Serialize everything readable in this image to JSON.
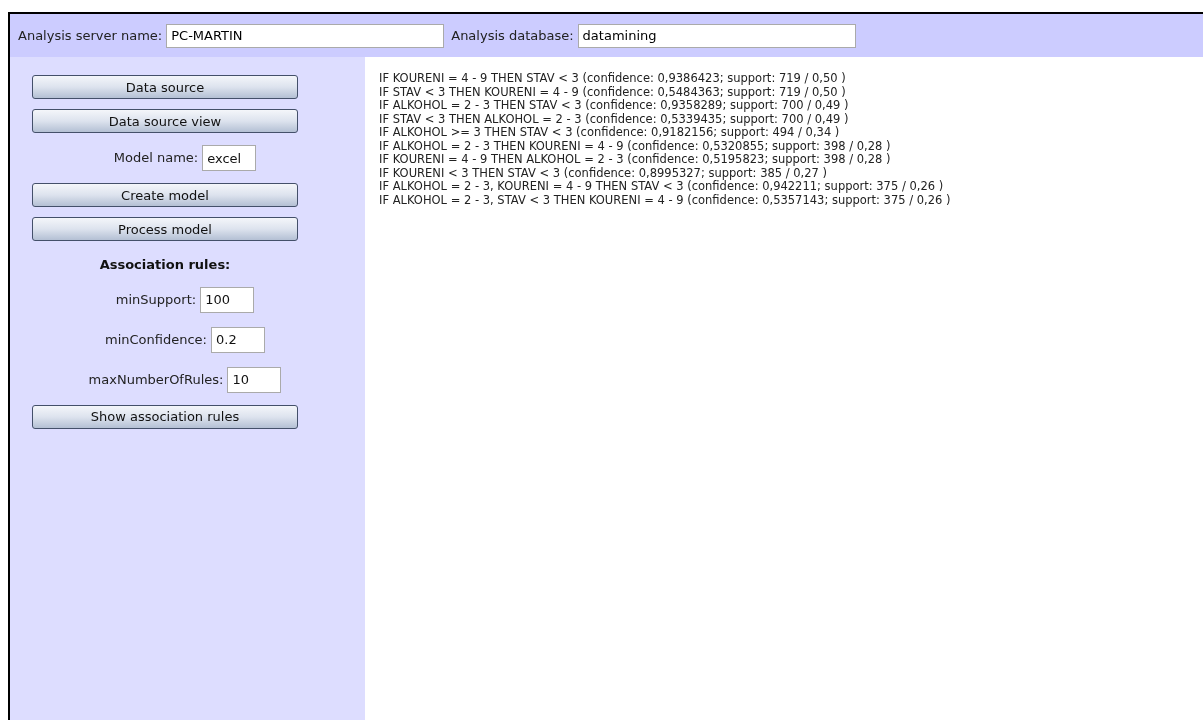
{
  "header": {
    "server_label": "Analysis server name:",
    "server_value": "PC-MARTIN",
    "database_label": "Analysis database:",
    "database_value": "datamining"
  },
  "sidebar": {
    "items": [
      {
        "kind": "button",
        "label": "Data source"
      },
      {
        "kind": "button",
        "label": "Data source view"
      },
      {
        "kind": "field",
        "label": "Model name:",
        "value": "excel"
      },
      {
        "kind": "button",
        "label": "Create model"
      },
      {
        "kind": "button",
        "label": "Process model"
      },
      {
        "kind": "heading",
        "label": "Association rules:"
      },
      {
        "kind": "field",
        "label": "minSupport:",
        "value": "100"
      },
      {
        "kind": "field",
        "label": "minConfidence:",
        "value": "0.2"
      },
      {
        "kind": "field",
        "label": "maxNumberOfRules:",
        "value": "10"
      },
      {
        "kind": "button",
        "label": "Show association rules"
      }
    ]
  },
  "rules": [
    "IF KOURENI = 4 - 9 THEN STAV < 3 (confidence: 0,9386423; support: 719 / 0,50 )",
    "IF STAV < 3 THEN KOURENI = 4 - 9 (confidence: 0,5484363; support: 719 / 0,50 )",
    "IF ALKOHOL = 2 - 3 THEN STAV < 3 (confidence: 0,9358289; support: 700 / 0,49 )",
    "IF STAV < 3 THEN ALKOHOL = 2 - 3 (confidence: 0,5339435; support: 700 / 0,49 )",
    "IF ALKOHOL >= 3 THEN STAV < 3 (confidence: 0,9182156; support: 494 / 0,34 )",
    "IF ALKOHOL = 2 - 3 THEN KOURENI = 4 - 9 (confidence: 0,5320855; support: 398 / 0,28 )",
    "IF KOURENI = 4 - 9 THEN ALKOHOL = 2 - 3 (confidence: 0,5195823; support: 398 / 0,28 )",
    "IF KOURENI < 3 THEN STAV < 3 (confidence: 0,8995327; support: 385 / 0,27 )",
    "IF ALKOHOL = 2 - 3, KOURENI = 4 - 9 THEN STAV < 3 (confidence: 0,942211; support: 375 / 0,26 )",
    "IF ALKOHOL = 2 - 3, STAV < 3 THEN KOURENI = 4 - 9 (confidence: 0,5357143; support: 375 / 0,26 )"
  ]
}
